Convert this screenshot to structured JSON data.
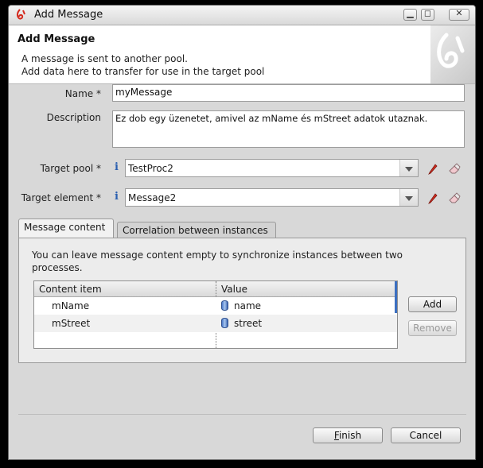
{
  "window": {
    "title": "Add Message",
    "buttons": {
      "minimize_glyph": "▁",
      "maximize_glyph": "◻",
      "close_glyph": "✕"
    }
  },
  "header": {
    "title": "Add Message",
    "description_line1": "A message is sent to another pool.",
    "description_line2": "Add data here to transfer for use in the target pool"
  },
  "form": {
    "name_label": "Name *",
    "name_value": "myMessage",
    "description_label": "Description",
    "description_value": "Ez dob egy üzenetet, amivel az mName és mStreet adatok utaznak.",
    "target_pool_label": "Target pool *",
    "target_pool_value": "TestProc2",
    "target_element_label": "Target element *",
    "target_element_value": "Message2",
    "info_glyph": "i"
  },
  "tabs": [
    {
      "label": "Message content",
      "active": true
    },
    {
      "label": "Correlation between instances",
      "active": false
    }
  ],
  "message_content": {
    "help_text": "You can leave message content empty to synchronize instances between two processes.",
    "columns": [
      "Content item",
      "Value"
    ],
    "rows": [
      {
        "item": "mName",
        "value": "name"
      },
      {
        "item": "mStreet",
        "value": "street"
      }
    ],
    "add_label": "Add",
    "remove_label": "Remove"
  },
  "footer": {
    "finish_first": "F",
    "finish_rest": "inish",
    "cancel_label": "Cancel"
  },
  "colors": {
    "accent": "#3b6fc1",
    "logo_red": "#d42a1e",
    "info_blue": "#2a5fb0"
  },
  "icons": [
    "app-logo-icon",
    "edit-pencil-icon",
    "eraser-icon",
    "data-cylinder-icon",
    "info-icon"
  ]
}
